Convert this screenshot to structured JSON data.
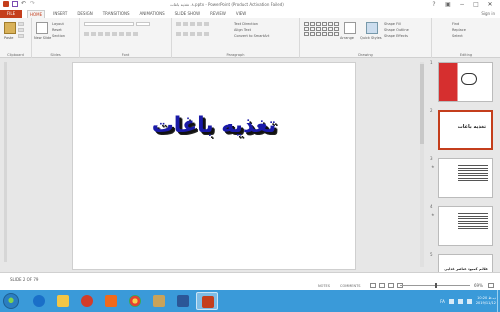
{
  "window": {
    "title": "٨. تغذیه باغات.pptx - PowerPoint (Product Activation Failed)",
    "controls": {
      "help": "?",
      "restore": "▣",
      "minimize": "−",
      "maximize": "□",
      "close": "✕"
    }
  },
  "ribbon_tabs": {
    "file": "FILE",
    "tabs": [
      "HOME",
      "INSERT",
      "DESIGN",
      "TRANSITIONS",
      "ANIMATIONS",
      "SLIDE SHOW",
      "REVIEW",
      "VIEW"
    ],
    "active": "HOME",
    "signin": "Sign in"
  },
  "ribbon": {
    "clipboard": {
      "label": "Clipboard",
      "paste": "Paste"
    },
    "slides": {
      "label": "Slides",
      "new_slide": "New Slide",
      "layout": "Layout",
      "reset": "Reset",
      "section": "Section"
    },
    "font": {
      "label": "Font"
    },
    "paragraph": {
      "label": "Paragraph",
      "text_direction": "Text Direction",
      "align_text": "Align Text",
      "convert": "Convert to SmartArt"
    },
    "drawing": {
      "label": "Drawing",
      "arrange": "Arrange",
      "quick_styles": "Quick Styles",
      "shape_fill": "Shape Fill",
      "shape_outline": "Shape Outline",
      "shape_effects": "Shape Effects"
    },
    "editing": {
      "label": "Editing",
      "find": "Find",
      "replace": "Replace",
      "select": "Select"
    }
  },
  "slide": {
    "title": "تغذیه باغات"
  },
  "thumbnails": [
    {
      "number": "1"
    },
    {
      "number": "2",
      "text": "تغذیه باغات"
    },
    {
      "number": "3"
    },
    {
      "number": "4"
    },
    {
      "number": "5",
      "text": "علائم کمبود عناصر غذایی"
    }
  ],
  "statusbar": {
    "slide_counter": "SLIDE 2 OF 79",
    "notes": "NOTES",
    "comments": "COMMENTS",
    "zoom": "69%"
  },
  "taskbar": {
    "language": "FA",
    "time": "10:20 ب.ظ",
    "date": "2019/11/12"
  },
  "colors": {
    "accent": "#c43e1c",
    "taskbar": "#3a9ad9",
    "slide_title": "#1a1aa8"
  }
}
